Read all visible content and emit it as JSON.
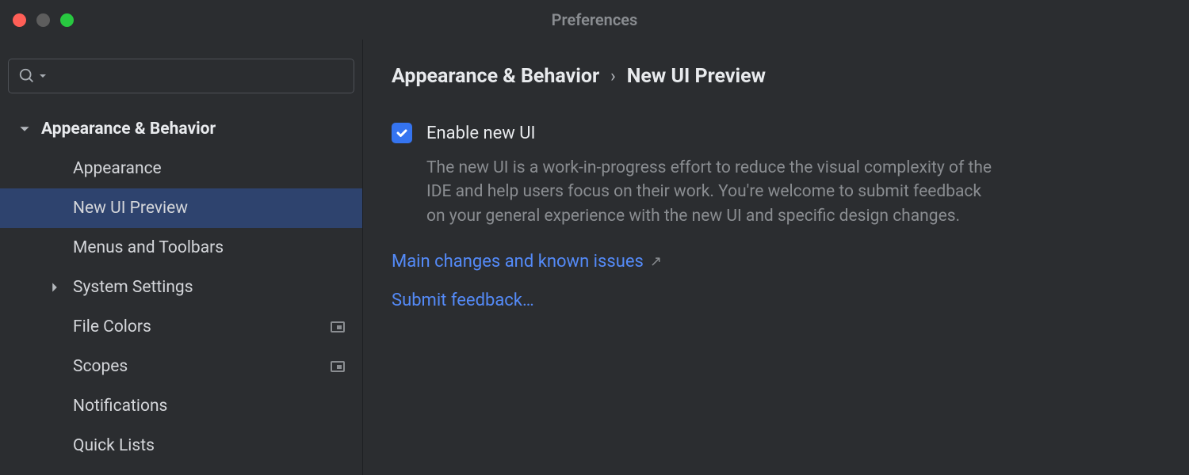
{
  "window": {
    "title": "Preferences"
  },
  "sidebar": {
    "search_placeholder": "",
    "category": {
      "label": "Appearance & Behavior",
      "expanded": true
    },
    "items": [
      {
        "label": "Appearance",
        "selected": false,
        "has_children": false,
        "project_scope": false
      },
      {
        "label": "New UI Preview",
        "selected": true,
        "has_children": false,
        "project_scope": false
      },
      {
        "label": "Menus and Toolbars",
        "selected": false,
        "has_children": false,
        "project_scope": false
      },
      {
        "label": "System Settings",
        "selected": false,
        "has_children": true,
        "project_scope": false
      },
      {
        "label": "File Colors",
        "selected": false,
        "has_children": false,
        "project_scope": true
      },
      {
        "label": "Scopes",
        "selected": false,
        "has_children": false,
        "project_scope": true
      },
      {
        "label": "Notifications",
        "selected": false,
        "has_children": false,
        "project_scope": false
      },
      {
        "label": "Quick Lists",
        "selected": false,
        "has_children": false,
        "project_scope": false
      }
    ]
  },
  "main": {
    "breadcrumb": {
      "parent": "Appearance & Behavior",
      "current": "New UI Preview"
    },
    "checkbox": {
      "label": "Enable new UI",
      "checked": true
    },
    "description": "The new UI is a work-in-progress effort to reduce the visual complexity of the IDE and help users focus on their work. You're welcome to submit feedback on your general experience with the new UI and specific design changes.",
    "links": {
      "changes": "Main changes and known issues",
      "feedback": "Submit feedback…"
    }
  }
}
